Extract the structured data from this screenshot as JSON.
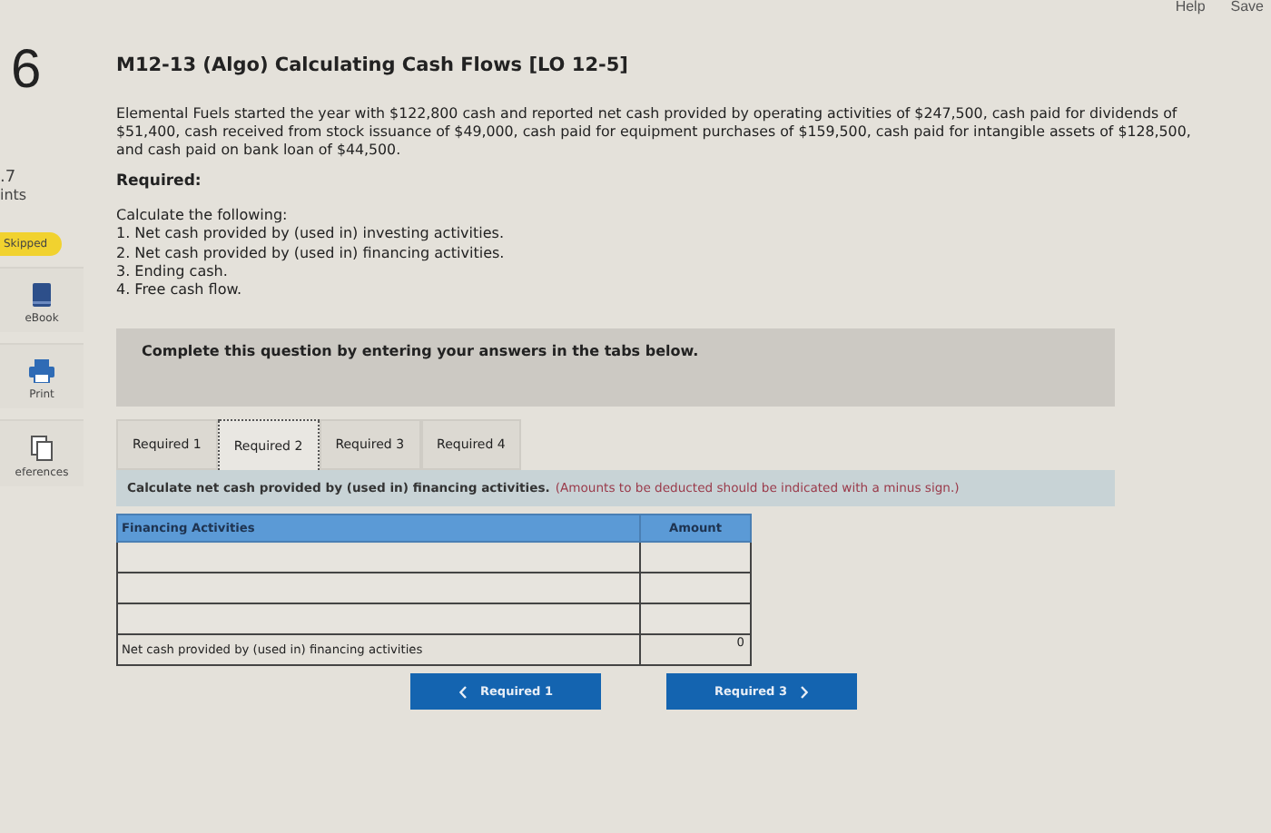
{
  "top_buttons": [
    "Help",
    "Save"
  ],
  "sidebar": {
    "question_number": "6",
    "points_value": ".7",
    "points_label": "ints",
    "status_badge": "Skipped",
    "tools": [
      {
        "kind": "book",
        "label": "eBook"
      },
      {
        "kind": "printer",
        "label": "Print"
      },
      {
        "kind": "copies",
        "label": "eferences"
      }
    ]
  },
  "problem": {
    "title": "M12-13 (Algo) Calculating Cash Flows [LO 12-5]",
    "description": "Elemental Fuels started the year with $122,800 cash and reported net cash provided by operating activities of $247,500, cash paid for dividends of $51,400, cash received from stock issuance of $49,000, cash paid for equipment purchases of $159,500, cash paid for intangible assets of $128,500, and cash paid on bank loan of $44,500.",
    "required_heading": "Required:",
    "instruction": "Calculate the following:",
    "tasks": [
      "1. Net cash provided by (used in) investing activities.",
      "2. Net cash provided by (used in) financing activities.",
      "3. Ending cash.",
      "4. Free cash flow."
    ]
  },
  "notice": "Complete this question by entering your answers in the tabs below.",
  "tabs": [
    {
      "label": "Required 1",
      "selected": false
    },
    {
      "label": "Required 2",
      "selected": true
    },
    {
      "label": "Required 3",
      "selected": false
    },
    {
      "label": "Required 4",
      "selected": false
    }
  ],
  "tab_instruction": {
    "text": "Calculate net cash provided by (used in) financing activities.",
    "note": "(Amounts to be deducted should be indicated with a minus sign.)"
  },
  "table": {
    "columns": [
      "Financing Activities",
      "Amount"
    ],
    "rows": [
      {
        "label": "",
        "amount": ""
      },
      {
        "label": "",
        "amount": ""
      },
      {
        "label": "",
        "amount": ""
      }
    ],
    "total": {
      "label": "Net cash provided by (used in) financing activities",
      "amount": "0"
    }
  },
  "nav_buttons": [
    {
      "kind": "prev",
      "label": "Required 1"
    },
    {
      "kind": "next",
      "label": "Required 3"
    }
  ]
}
